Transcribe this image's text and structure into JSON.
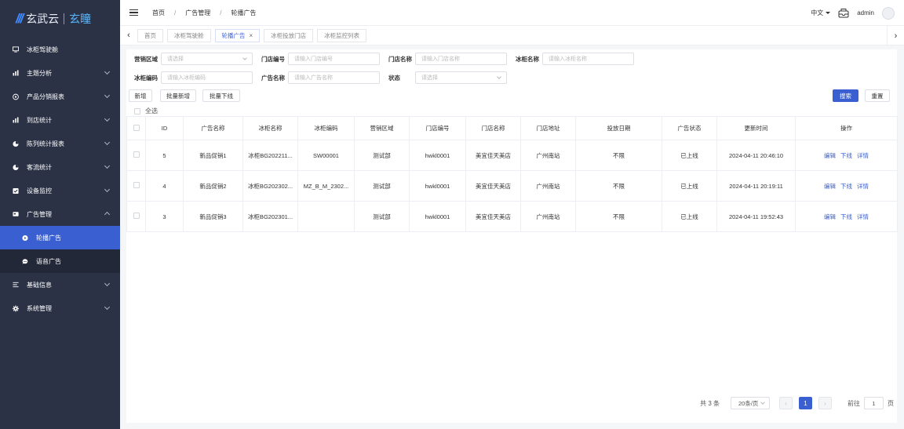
{
  "brand": {
    "logo_text": "玄武云",
    "logo_text2": "玄瞳"
  },
  "sidebar": {
    "items": [
      {
        "label": "冰柜驾驶舱",
        "icon": "monitor-icon",
        "expandable": false
      },
      {
        "label": "主题分析",
        "icon": "bar-chart-icon",
        "expandable": true
      },
      {
        "label": "产品分销报表",
        "icon": "target-icon",
        "expandable": true
      },
      {
        "label": "到店统计",
        "icon": "bar-chart-icon",
        "expandable": true
      },
      {
        "label": "陈列统计报表",
        "icon": "pie-chart-icon",
        "expandable": true
      },
      {
        "label": "客流统计",
        "icon": "pie-chart-icon",
        "expandable": true
      },
      {
        "label": "设备监控",
        "icon": "checkbox-icon",
        "expandable": true
      },
      {
        "label": "广告管理",
        "icon": "card-icon",
        "expandable": true,
        "expanded": true
      },
      {
        "label": "轮播广告",
        "icon": "play-circle-icon",
        "sub": true,
        "active": true
      },
      {
        "label": "语音广告",
        "icon": "chat-bubble-icon",
        "sub": true
      },
      {
        "label": "基础信息",
        "icon": "list-icon",
        "expandable": true
      },
      {
        "label": "系统管理",
        "icon": "gear-icon",
        "expandable": true
      }
    ]
  },
  "header": {
    "breadcrumbs": [
      "首页",
      "广告管理",
      "轮播广告"
    ],
    "language": "中文",
    "username": "admin"
  },
  "tabs": [
    {
      "label": "首页",
      "active": false
    },
    {
      "label": "冰柜驾驶舱",
      "active": false
    },
    {
      "label": "轮播广告",
      "active": true,
      "closable": true
    },
    {
      "label": "冰柜投放门店",
      "active": false
    },
    {
      "label": "冰柜监控列表",
      "active": false
    }
  ],
  "filters": {
    "region": {
      "label": "营销区域",
      "placeholder": "请选择"
    },
    "store_code": {
      "label": "门店编号",
      "placeholder": "请输入门店编号"
    },
    "store_name": {
      "label": "门店名称",
      "placeholder": "请输入门店名称"
    },
    "fridge_name": {
      "label": "冰柜名称",
      "placeholder": "请输入冰柜名称"
    },
    "fridge_code": {
      "label": "冰柜编码",
      "placeholder": "请输入冰柜编码"
    },
    "ad_name": {
      "label": "广告名称",
      "placeholder": "请输入广告名称"
    },
    "status": {
      "label": "状态",
      "placeholder": "请选择"
    }
  },
  "actions": {
    "add": "新增",
    "batch_add": "批量新增",
    "batch_offline": "批量下线",
    "search": "搜索",
    "reset": "重置",
    "select_all": "全选"
  },
  "table": {
    "columns": [
      "ID",
      "广告名称",
      "冰柜名称",
      "冰柜编码",
      "营销区域",
      "门店编号",
      "门店名称",
      "门店地址",
      "投放日期",
      "广告状态",
      "更新时间",
      "操作"
    ],
    "rows": [
      {
        "id": "5",
        "ad_name": "新品促销1",
        "fridge_name": "冰柜BG202211...",
        "fridge_code": "SW00001",
        "region": "测试部",
        "store_code": "hwkl0001",
        "store_name": "美宜佳天美店",
        "address": "广州南站",
        "date": "不限",
        "status": "已上线",
        "updated": "2024-04-11 20:46:10"
      },
      {
        "id": "4",
        "ad_name": "新品促销2",
        "fridge_name": "冰柜BG202302...",
        "fridge_code": "MZ_B_M_2302...",
        "region": "测试部",
        "store_code": "hwkl0001",
        "store_name": "美宜佳天美店",
        "address": "广州南站",
        "date": "不限",
        "status": "已上线",
        "updated": "2024-04-11 20:19:11"
      },
      {
        "id": "3",
        "ad_name": "新品促销3",
        "fridge_name": "冰柜BG202301...",
        "fridge_code": "",
        "region": "测试部",
        "store_code": "hwkl0001",
        "store_name": "美宜佳天美店",
        "address": "广州南站",
        "date": "不限",
        "status": "已上线",
        "updated": "2024-04-11 19:52:43"
      }
    ],
    "row_ops": {
      "edit": "编辑",
      "offline": "下线",
      "detail": "详情"
    }
  },
  "pagination": {
    "total_text": "共 3 条",
    "page_size": "20条/页",
    "current_page": "1",
    "goto_label": "前往",
    "goto_value": "1",
    "goto_unit": "页"
  },
  "colors": {
    "primary": "#3a5fd0",
    "sidebar_bg": "#2c3245"
  }
}
